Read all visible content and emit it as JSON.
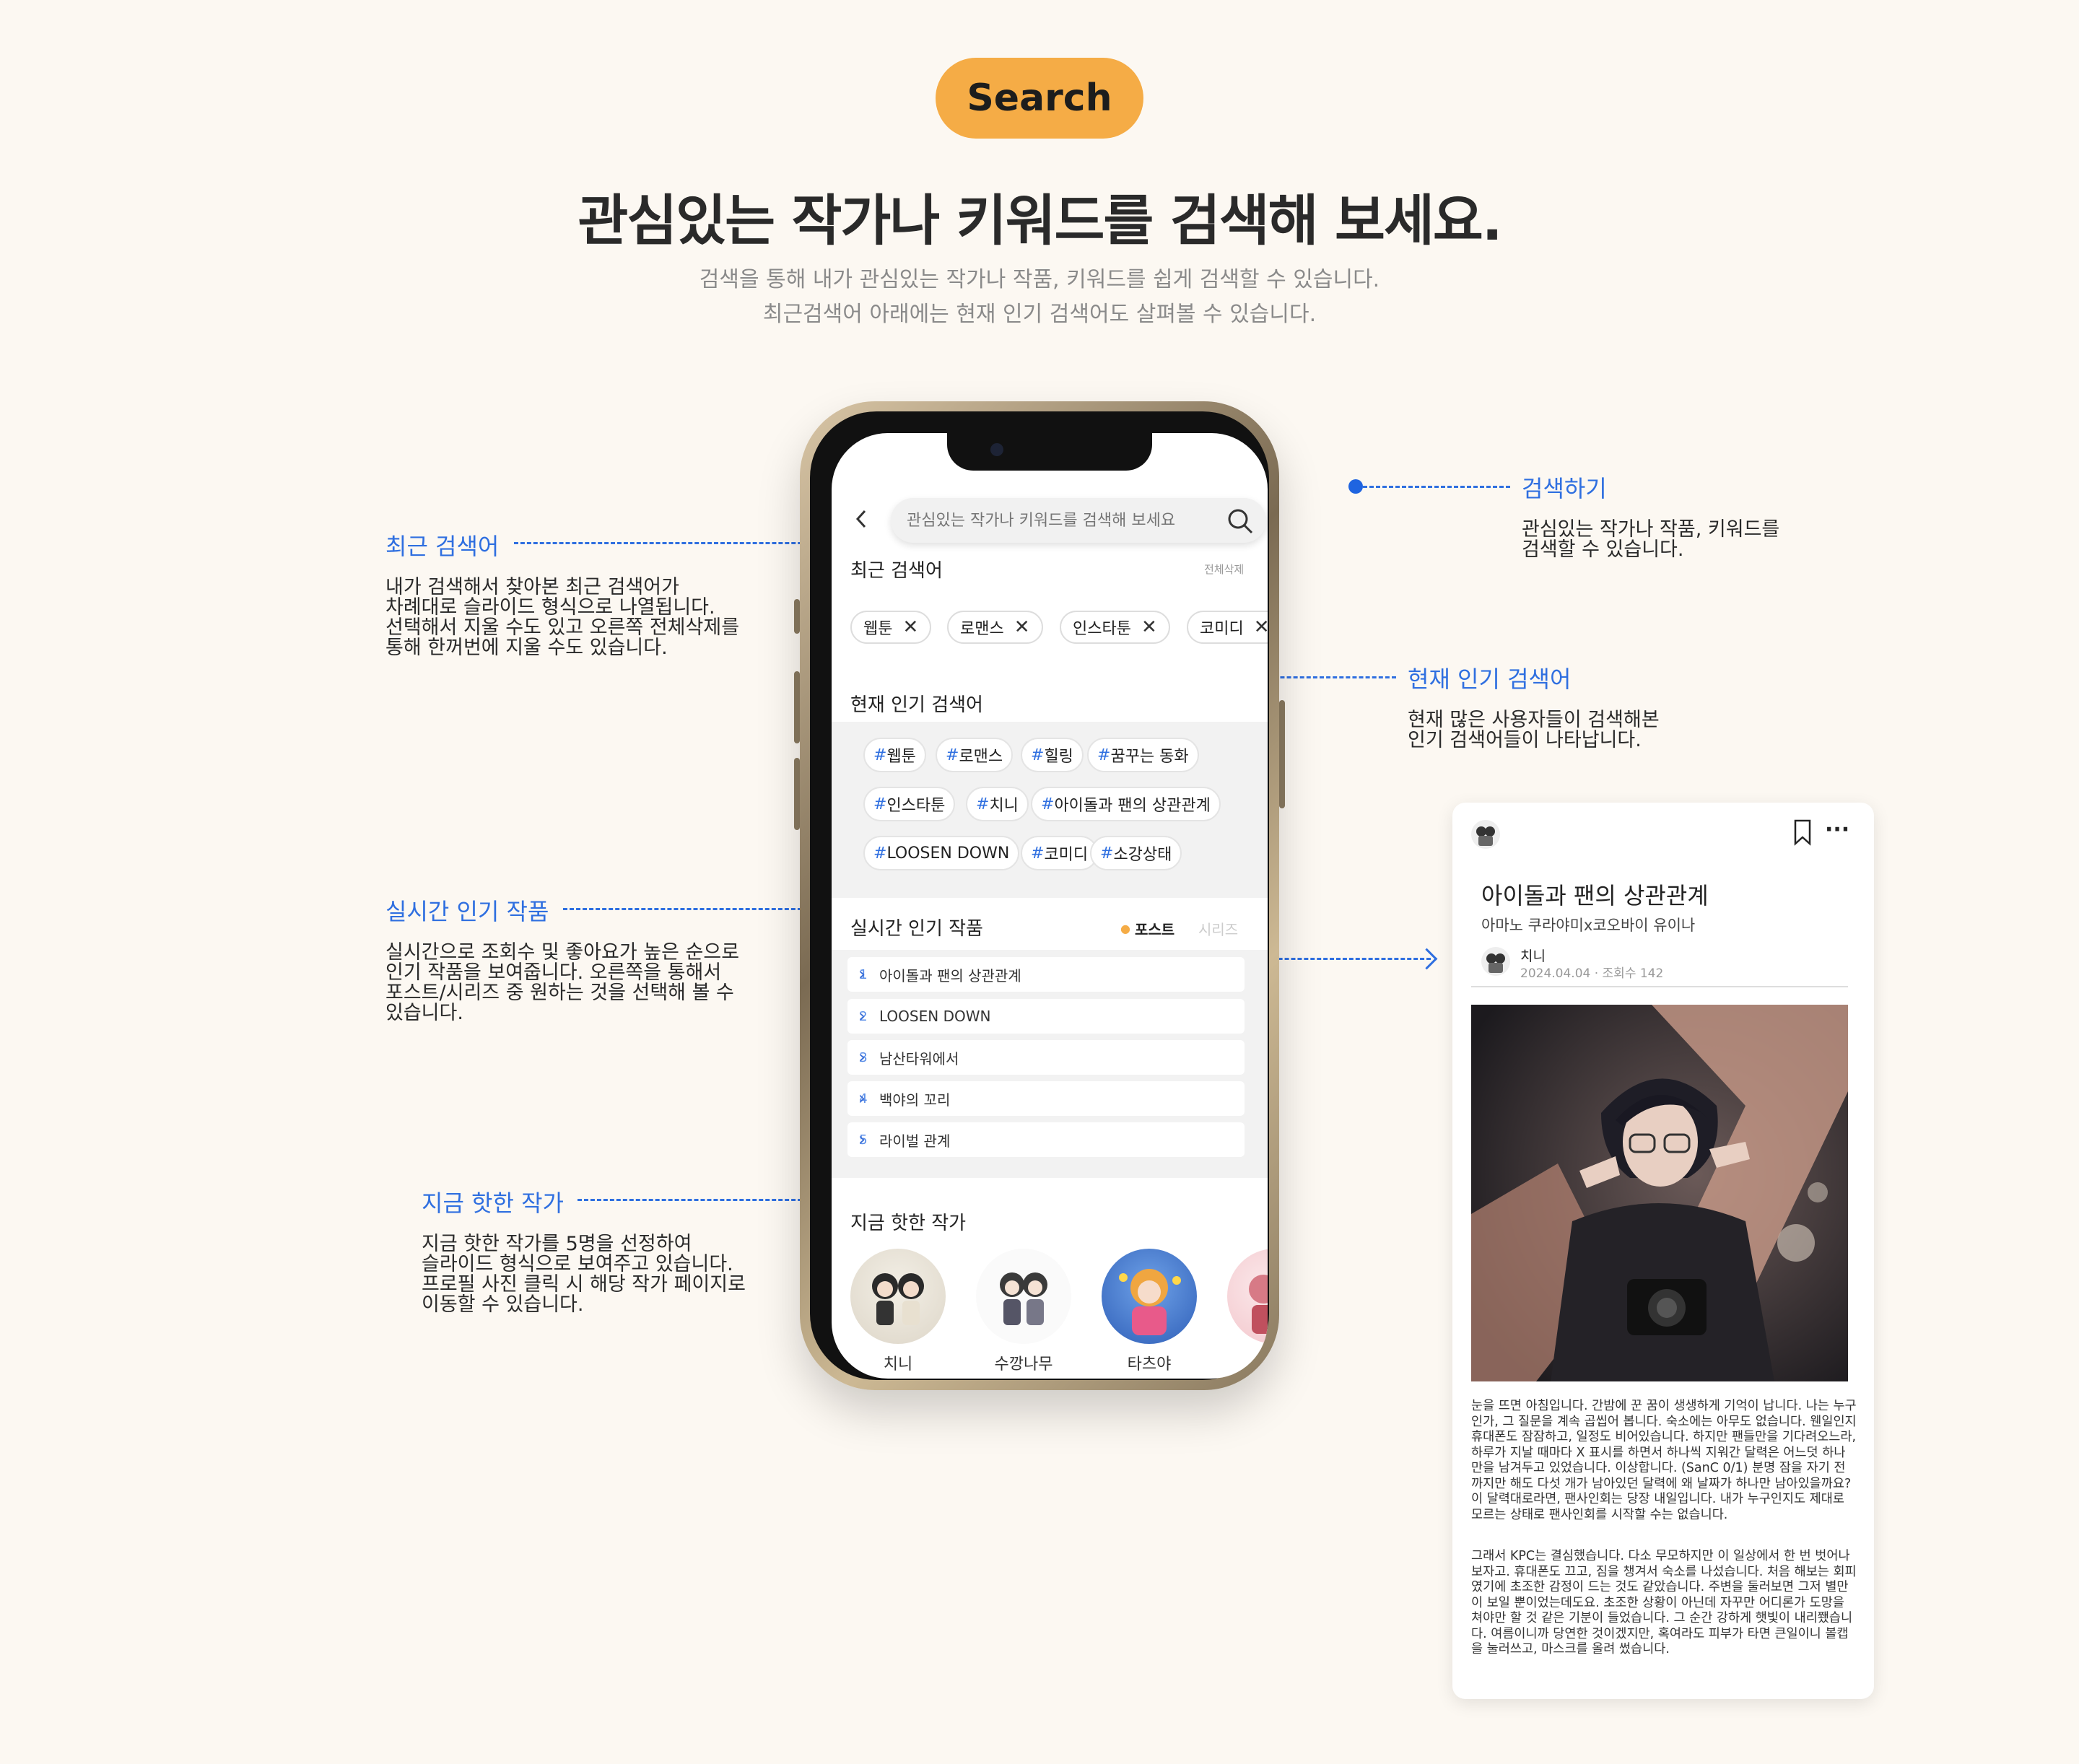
{
  "header": {
    "badge": "Search",
    "headline": "관심있는 작가나 키워드를 검색해 보세요.",
    "sub1": "검색을 통해 내가 관심있는 작가나 작품, 키워드를 쉽게 검색할 수 있습니다.",
    "sub2": "최근검색어 아래에는 현재 인기 검색어도 살펴볼 수 있습니다."
  },
  "annotations": {
    "search": {
      "title": "검색하기",
      "desc": [
        "관심있는 작가나 작품, 키워드를",
        "검색할 수 있습니다."
      ]
    },
    "recent": {
      "title": "최근 검색어",
      "desc": [
        "내가 검색해서 찾아본 최근 검색어가",
        "차례대로 슬라이드 형식으로 나열됩니다.",
        "선택해서 지울 수도 있고 오른쪽 전체삭제를",
        "통해 한꺼번에 지울 수도 있습니다."
      ]
    },
    "popular": {
      "title": "현재 인기 검색어",
      "desc": [
        "현재 많은 사용자들이 검색해본",
        "인기 검색어들이 나타납니다."
      ]
    },
    "realtime": {
      "title": "실시간 인기 작품",
      "desc": [
        "실시간으로 조회수 및 좋아요가 높은 순으로",
        "인기 작품을 보여줍니다. 오른쪽을 통해서",
        "포스트/시리즈 중 원하는 것을 선택해 볼 수",
        "있습니다."
      ]
    },
    "hot": {
      "title": "지금 핫한 작가",
      "desc": [
        "지금 핫한 작가를 5명을 선정하여",
        "슬라이드 형식으로 보여주고 있습니다.",
        "프로필 사진 클릭 시 해당 작가 페이지로",
        "이동할 수 있습니다."
      ]
    }
  },
  "phone": {
    "search_placeholder": "관심있는 작가나 키워드를 검색해 보세요",
    "recent_title": "최근 검색어",
    "delete_all": "전체삭제",
    "recent_chips": [
      "웹툰",
      "로맨스",
      "인스타툰",
      "코미디"
    ],
    "chip_close": "✕",
    "popular_title": "현재 인기 검색어",
    "hash": "#",
    "tags": [
      "웹툰",
      "로맨스",
      "힐링",
      "꿈꾸는 동화",
      "인스타툰",
      "치니",
      "아이돌과 팬의 상관관계",
      "LOOSEN DOWN",
      "코미디",
      "소강상태"
    ],
    "realtime_title": "실시간 인기 작품",
    "tab_post": "포스트",
    "tab_series": "시리즈",
    "ranks": [
      {
        "n": "1",
        "label": "아이돌과 팬의 상관관계"
      },
      {
        "n": "2",
        "label": "LOOSEN DOWN"
      },
      {
        "n": "3",
        "label": "남산타워에서"
      },
      {
        "n": "4",
        "label": "백야의 꼬리"
      },
      {
        "n": "5",
        "label": "라이벌 관계"
      }
    ],
    "chevron": "›",
    "hot_title": "지금 핫한 작가",
    "authors": [
      "치니",
      "수깡나무",
      "타츠야"
    ]
  },
  "post": {
    "title": "아이돌과 팬의 상관관계",
    "subtitle": "아마노 쿠라야미x코오바이 유이나",
    "author": "치니",
    "meta": "2024.04.04 · 조회수 142",
    "more": "···",
    "body1": "눈을 뜨면 아침입니다. 간밤에 꾼 꿈이 생생하게 기억이 납니다. 나는 누구인가, 그 질문을 계속 곱씹어 봅니다. 숙소에는 아무도 없습니다. 웬일인지 휴대폰도 잠잠하고, 일정도 비어있습니다. 하지만 팬들만을 기다려오느라, 하루가 지날 때마다 X 표시를 하면서 하나씩 지워간 달력은 어느덧 하나만을 남겨두고 있었습니다. 이상합니다. (SanC 0/1) 분명 잠을 자기 전까지만 해도 다섯 개가 남아있던 달력에 왜 날짜가 하나만 남아있을까요? 이 달력대로라면, 팬사인회는 당장 내일입니다. 내가 누구인지도 제대로 모르는 상태로 팬사인회를 시작할 수는 없습니다.",
    "body2": "그래서 KPC는 결심했습니다. 다소 무모하지만 이 일상에서 한 번 벗어나 보자고. 휴대폰도 끄고, 짐을 챙겨서 숙소를 나섰습니다. 처음 해보는 회피였기에 초조한 감정이 드는 것도 같았습니다. 주변을 둘러보면 그저 별만이 보일 뿐이었는데도요. 초조한 상황이 아닌데 자꾸만 어디론가 도망을 쳐야만 할 것 같은 기분이 들었습니다. 그 순간 강하게 햇빛이 내리쬈습니다. 여름이니까 당연한 것이겠지만, 혹여라도 피부가 타면 큰일이니 볼캡을 눌러쓰고, 마스크를 올려 썼습니다."
  },
  "colors": {
    "accent": "#2f6fe0",
    "badge": "#f5ac46",
    "background": "#fcf8f2"
  }
}
